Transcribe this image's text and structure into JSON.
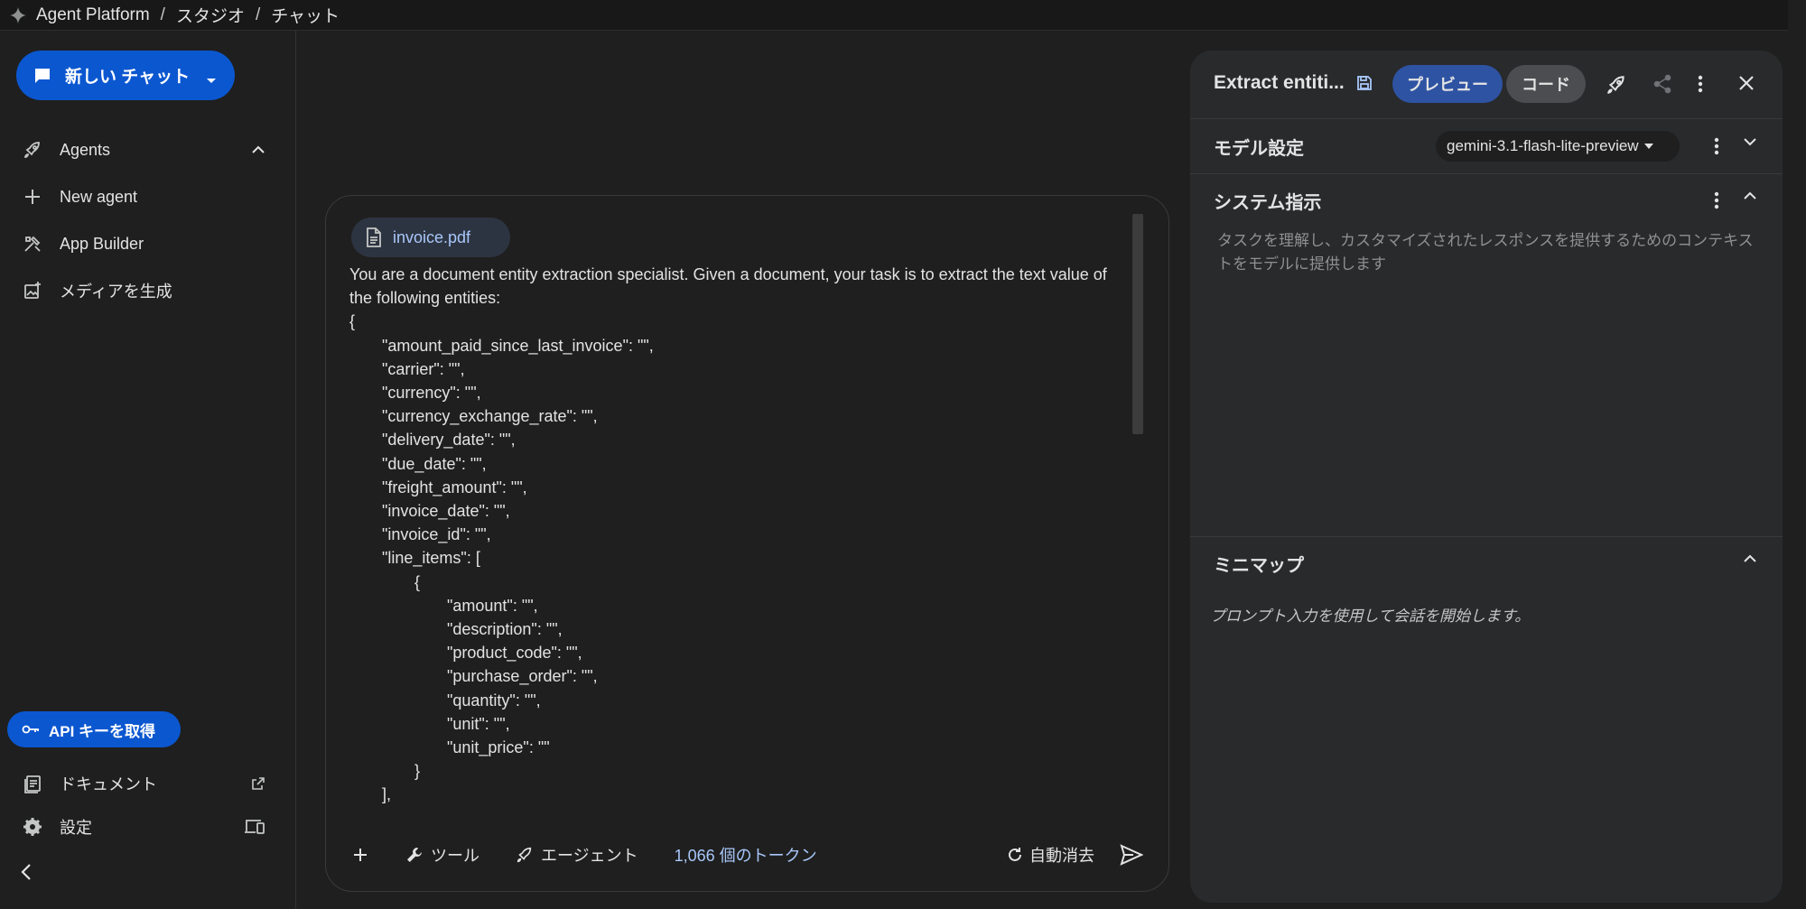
{
  "topbar": {
    "crumbs": [
      "Agent Platform",
      "スタジオ",
      "チャット"
    ],
    "separator": "/"
  },
  "sidebar": {
    "new_chat_label": "新しい チャット",
    "items": [
      {
        "label": "Agents",
        "icon": "rocket-icon"
      },
      {
        "label": "New agent",
        "icon": "plus-icon"
      },
      {
        "label": "App Builder",
        "icon": "tools-icon"
      },
      {
        "label": "メディアを生成",
        "icon": "image-add-icon"
      }
    ],
    "api_key_label": "API キーを取得",
    "docs_label": "ドキュメント",
    "settings_label": "設定"
  },
  "chat": {
    "file_chip": "invoice.pdf",
    "prompt_lines": [
      {
        "text": "You are a document entity extraction specialist. Given a document, your task is to extract the text value of",
        "indent": 0
      },
      {
        "text": "the following entities:",
        "indent": 0
      },
      {
        "text": "{",
        "indent": 0
      },
      {
        "text": "\"amount_paid_since_last_invoice\": \"\",",
        "indent": 1
      },
      {
        "text": "\"carrier\": \"\",",
        "indent": 1
      },
      {
        "text": "\"currency\": \"\",",
        "indent": 1
      },
      {
        "text": "\"currency_exchange_rate\": \"\",",
        "indent": 1
      },
      {
        "text": "\"delivery_date\": \"\",",
        "indent": 1
      },
      {
        "text": "\"due_date\": \"\",",
        "indent": 1
      },
      {
        "text": "\"freight_amount\": \"\",",
        "indent": 1
      },
      {
        "text": "\"invoice_date\": \"\",",
        "indent": 1
      },
      {
        "text": "\"invoice_id\": \"\",",
        "indent": 1
      },
      {
        "text": "\"line_items\": [",
        "indent": 1
      },
      {
        "text": "{",
        "indent": 2
      },
      {
        "text": "\"amount\": \"\",",
        "indent": 3
      },
      {
        "text": "\"description\": \"\",",
        "indent": 3
      },
      {
        "text": "\"product_code\": \"\",",
        "indent": 3
      },
      {
        "text": "\"purchase_order\": \"\",",
        "indent": 3
      },
      {
        "text": "\"quantity\": \"\",",
        "indent": 3
      },
      {
        "text": "\"unit\": \"\",",
        "indent": 3
      },
      {
        "text": "\"unit_price\": \"\"",
        "indent": 3
      },
      {
        "text": "}",
        "indent": 2
      },
      {
        "text": "],",
        "indent": 1
      }
    ],
    "toolbar": {
      "tools_label": "ツール",
      "agent_label": "エージェント",
      "tokens_label": "1,066 個のトークン",
      "auto_clear_label": "自動消去"
    }
  },
  "panel": {
    "title": "Extract entiti...",
    "preview_label": "プレビュー",
    "code_label": "コード",
    "model_section_label": "モデル設定",
    "model_name": "gemini-3.1-flash-lite-preview",
    "system_section_label": "システム指示",
    "system_placeholder": "タスクを理解し、カスタマイズされたレスポンスを提供するためのコンテキストをモデルに提供します",
    "minimap_label": "ミニマップ",
    "minimap_text": "プロンプト入力を使用して会話を開始します。"
  },
  "colors": {
    "accent": "#0b57d0",
    "link": "#a8c7fa",
    "background": "#1f1f1f",
    "panel": "#282a2c"
  }
}
